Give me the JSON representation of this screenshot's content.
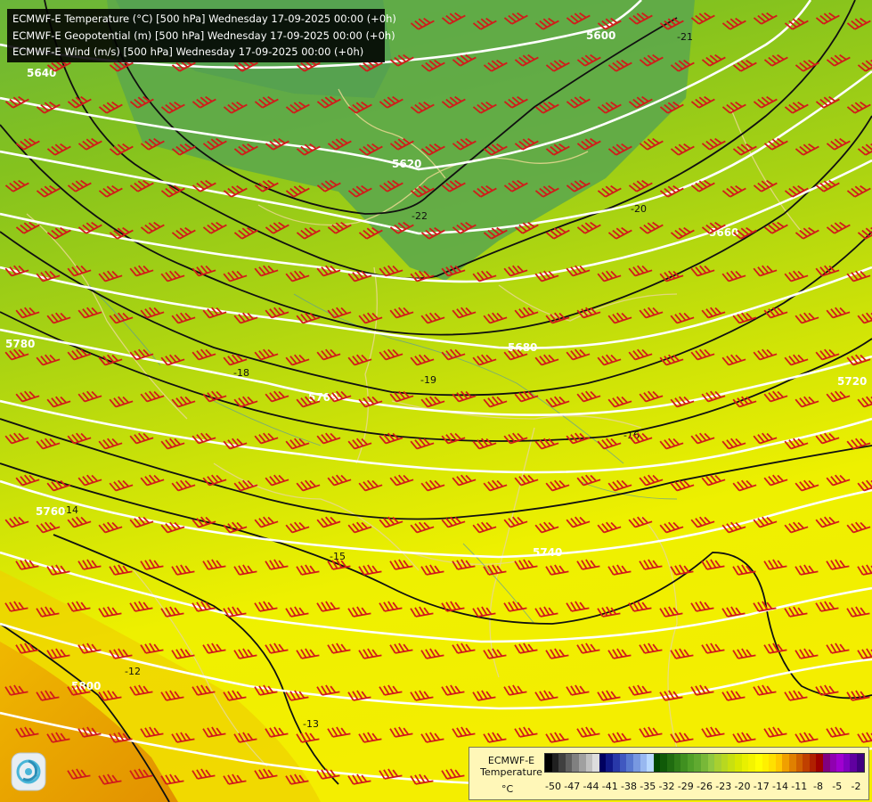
{
  "header": {
    "line1": "ECMWF-E Temperature (°C) [500 hPa] Wednesday 17-09-2025 00:00 (+0h)",
    "line2": "ECMWF-E Geopotential (m) [500 hPa] Wednesday 17-09-2025 00:00 (+0h)",
    "line3": "ECMWF-E Wind (m/s) [500 hPa] Wednesday 17-09-2025 00:00 (+0h)"
  },
  "legend": {
    "title": "ECMWF-E\nTemperature",
    "unit": "°C",
    "ticks": [
      "-50",
      "-47",
      "-44",
      "-41",
      "-38",
      "-35",
      "-32",
      "-29",
      "-26",
      "-23",
      "-20",
      "-17",
      "-14",
      "-11",
      "-8",
      "-5",
      "-2"
    ],
    "colors": [
      "#000000",
      "#202020",
      "#404040",
      "#606060",
      "#808080",
      "#a0a0a0",
      "#c0c0c0",
      "#dddddd",
      "#000060",
      "#101888",
      "#2838a8",
      "#4058c0",
      "#5878d0",
      "#7898e0",
      "#98b8f0",
      "#b8d8ff",
      "#004800",
      "#105a08",
      "#206c10",
      "#307e18",
      "#409020",
      "#50a028",
      "#60aa30",
      "#78b838",
      "#90c840",
      "#a8d030",
      "#b8d820",
      "#c8e010",
      "#d8e800",
      "#e8f000",
      "#f4f400",
      "#ffff00",
      "#fff000",
      "#ffe000",
      "#ffc800",
      "#f0a000",
      "#e08000",
      "#d06000",
      "#c04000",
      "#b02000",
      "#a00000",
      "#800080",
      "#9000b0",
      "#a000d0",
      "#8000c0",
      "#6000a0",
      "#400080"
    ]
  },
  "geopotential_labels": [
    "5600",
    "5620",
    "5640",
    "5660",
    "5680",
    "5700",
    "5720",
    "5740",
    "5760",
    "5780",
    "5800"
  ],
  "temperature_labels": [
    "-22",
    "-21",
    "-20",
    "-19",
    "-18",
    "-16",
    "-15",
    "-14",
    "-13",
    "-12"
  ]
}
